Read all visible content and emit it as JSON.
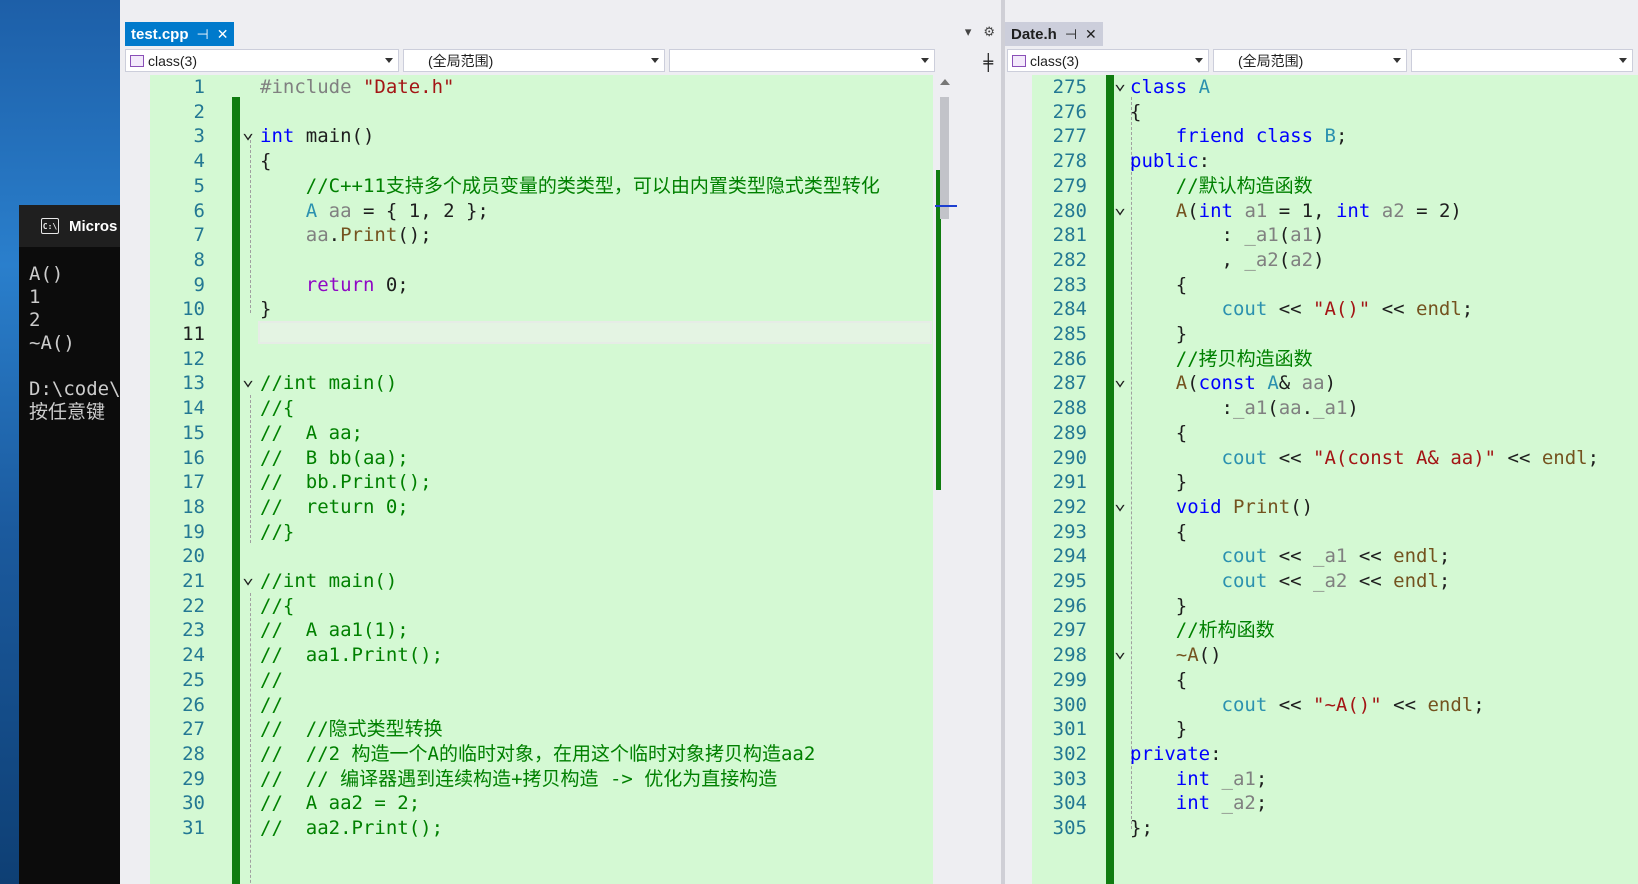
{
  "console": {
    "title": "Micros",
    "icon": "console-icon",
    "output": "A()\n1\n2\n~A()\n\nD:\\code\\\n按任意键"
  },
  "left": {
    "tab": {
      "label": "test.cpp",
      "pin": "⊣",
      "close": "✕"
    },
    "tools": {
      "dropdown": "▾",
      "settings": "⚙"
    },
    "nav": {
      "class": "class(3)",
      "scope": "(全局范围)",
      "member": ""
    },
    "lines": [
      {
        "n": "1",
        "html": "<span class=\"pp\">#include </span><span class=\"str\">\"Date.h\"</span>"
      },
      {
        "n": "2",
        "html": ""
      },
      {
        "n": "3",
        "html": "<span class=\"kw\">int</span> main()",
        "fold": true
      },
      {
        "n": "4",
        "html": "{"
      },
      {
        "n": "5",
        "html": "    <span class=\"cmt\">//C++11支持多个成员变量的类类型，可以由内置类型隐式类型转化</span>"
      },
      {
        "n": "6",
        "html": "    <span class=\"ty\">A</span> <span class=\"par\">aa</span> = { 1, 2 };"
      },
      {
        "n": "7",
        "html": "    <span class=\"par\">aa</span>.<span class=\"fn\">Print</span>();"
      },
      {
        "n": "8",
        "html": ""
      },
      {
        "n": "9",
        "html": "    <span class=\"kw2\">return</span> 0;"
      },
      {
        "n": "10",
        "html": "}"
      },
      {
        "n": "11",
        "html": "",
        "current": true
      },
      {
        "n": "12",
        "html": ""
      },
      {
        "n": "13",
        "html": "<span class=\"cmt\">//int main()</span>",
        "fold": true
      },
      {
        "n": "14",
        "html": "<span class=\"cmt\">//{</span>"
      },
      {
        "n": "15",
        "html": "<span class=\"cmt\">//  A aa;</span>"
      },
      {
        "n": "16",
        "html": "<span class=\"cmt\">//  B bb(aa);</span>"
      },
      {
        "n": "17",
        "html": "<span class=\"cmt\">//  bb.Print();</span>"
      },
      {
        "n": "18",
        "html": "<span class=\"cmt\">//  return 0;</span>"
      },
      {
        "n": "19",
        "html": "<span class=\"cmt\">//}</span>"
      },
      {
        "n": "20",
        "html": ""
      },
      {
        "n": "21",
        "html": "<span class=\"cmt\">//int main()</span>",
        "fold": true
      },
      {
        "n": "22",
        "html": "<span class=\"cmt\">//{</span>"
      },
      {
        "n": "23",
        "html": "<span class=\"cmt\">//  A aa1(1);</span>"
      },
      {
        "n": "24",
        "html": "<span class=\"cmt\">//  aa1.Print();</span>"
      },
      {
        "n": "25",
        "html": "<span class=\"cmt\">//</span>"
      },
      {
        "n": "26",
        "html": "<span class=\"cmt\">//</span>"
      },
      {
        "n": "27",
        "html": "<span class=\"cmt\">//  //隐式类型转换</span>"
      },
      {
        "n": "28",
        "html": "<span class=\"cmt\">//  //2 构造一个A的临时对象，在用这个临时对象拷贝构造aa2</span>"
      },
      {
        "n": "29",
        "html": "<span class=\"cmt\">//  // 编译器遇到连续构造+拷贝构造 -> 优化为直接构造</span>"
      },
      {
        "n": "30",
        "html": "<span class=\"cmt\">//  A aa2 = 2;</span>"
      },
      {
        "n": "31",
        "html": "<span class=\"cmt\">//  aa2.Print();</span>"
      }
    ]
  },
  "right": {
    "tab": {
      "label": "Date.h",
      "pin": "⊣",
      "close": "✕"
    },
    "nav": {
      "class": "class(3)",
      "scope": "(全局范围)",
      "member": ""
    },
    "lines": [
      {
        "n": "275",
        "html": "<span class=\"kw\">class</span> <span class=\"ty\">A</span>",
        "fold": true
      },
      {
        "n": "276",
        "html": "{"
      },
      {
        "n": "277",
        "html": "    <span class=\"kw\">friend</span> <span class=\"kw\">class</span> <span class=\"ty\">B</span>;"
      },
      {
        "n": "278",
        "html": "<span class=\"kw\">public</span>:"
      },
      {
        "n": "279",
        "html": "    <span class=\"cmt\">//默认构造函数</span>"
      },
      {
        "n": "280",
        "html": "    <span class=\"fn\">A</span>(<span class=\"kw\">int</span> <span class=\"par\">a1</span> = 1, <span class=\"kw\">int</span> <span class=\"par\">a2</span> = 2)",
        "fold": true
      },
      {
        "n": "281",
        "html": "        : <span class=\"mem\">_a1</span>(<span class=\"par\">a1</span>)"
      },
      {
        "n": "282",
        "html": "        , <span class=\"mem\">_a2</span>(<span class=\"par\">a2</span>)"
      },
      {
        "n": "283",
        "html": "    {"
      },
      {
        "n": "284",
        "html": "        <span class=\"ty\">cout</span> << <span class=\"str\">\"A()\"</span> << <span class=\"fn\">endl</span>;"
      },
      {
        "n": "285",
        "html": "    }"
      },
      {
        "n": "286",
        "html": "    <span class=\"cmt\">//拷贝构造函数</span>"
      },
      {
        "n": "287",
        "html": "    <span class=\"fn\">A</span>(<span class=\"kw\">const</span> <span class=\"ty\">A</span>& <span class=\"par\">aa</span>)",
        "fold": true
      },
      {
        "n": "288",
        "html": "        :<span class=\"mem\">_a1</span>(<span class=\"par\">aa</span>.<span class=\"mem\">_a1</span>)"
      },
      {
        "n": "289",
        "html": "    {"
      },
      {
        "n": "290",
        "html": "        <span class=\"ty\">cout</span> << <span class=\"str\">\"A(const A& aa)\"</span> << <span class=\"fn\">endl</span>;"
      },
      {
        "n": "291",
        "html": "    }"
      },
      {
        "n": "292",
        "html": "    <span class=\"kw\">void</span> <span class=\"fn\">Print</span>()",
        "fold": true
      },
      {
        "n": "293",
        "html": "    {"
      },
      {
        "n": "294",
        "html": "        <span class=\"ty\">cout</span> << <span class=\"mem\">_a1</span> << <span class=\"fn\">endl</span>;"
      },
      {
        "n": "295",
        "html": "        <span class=\"ty\">cout</span> << <span class=\"mem\">_a2</span> << <span class=\"fn\">endl</span>;"
      },
      {
        "n": "296",
        "html": "    }"
      },
      {
        "n": "297",
        "html": "    <span class=\"cmt\">//析构函数</span>"
      },
      {
        "n": "298",
        "html": "    <span class=\"fn\">~A</span>()",
        "fold": true
      },
      {
        "n": "299",
        "html": "    {"
      },
      {
        "n": "300",
        "html": "        <span class=\"ty\">cout</span> << <span class=\"str\">\"~A()\"</span> << <span class=\"fn\">endl</span>;"
      },
      {
        "n": "301",
        "html": "    }"
      },
      {
        "n": "302",
        "html": "<span class=\"kw\">private</span>:"
      },
      {
        "n": "303",
        "html": "    <span class=\"kw\">int</span> <span class=\"mem\">_a1</span>;"
      },
      {
        "n": "304",
        "html": "    <span class=\"kw\">int</span> <span class=\"mem\">_a2</span>;"
      },
      {
        "n": "305",
        "html": "};"
      }
    ]
  }
}
